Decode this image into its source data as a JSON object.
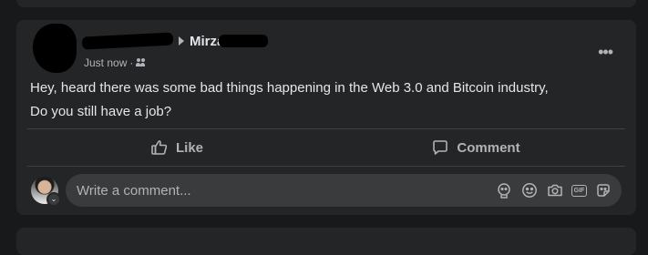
{
  "post": {
    "target_name": "Mirza",
    "timestamp": "Just now",
    "separator": "·",
    "body_lines": [
      "Hey, heard there was some bad things happening in the Web 3.0 and Bitcoin industry,",
      "Do you still have a job?"
    ],
    "more_icon": "•••"
  },
  "actions": {
    "like_label": "Like",
    "comment_label": "Comment"
  },
  "composer": {
    "placeholder": "Write a comment...",
    "gif_label": "GIF",
    "badge_icon": "chevron-down-icon"
  },
  "icons": [
    "audience-icon",
    "more-icon",
    "like-icon",
    "comment-icon",
    "sticker-icon",
    "emoji-icon",
    "camera-icon",
    "gif-icon",
    "avatar-sticker-icon"
  ],
  "colors": {
    "background": "#18191a",
    "card": "#242526",
    "input": "#3a3b3c",
    "text_primary": "#e4e6eb",
    "text_secondary": "#b0b3b8",
    "divider": "#3e4042"
  }
}
